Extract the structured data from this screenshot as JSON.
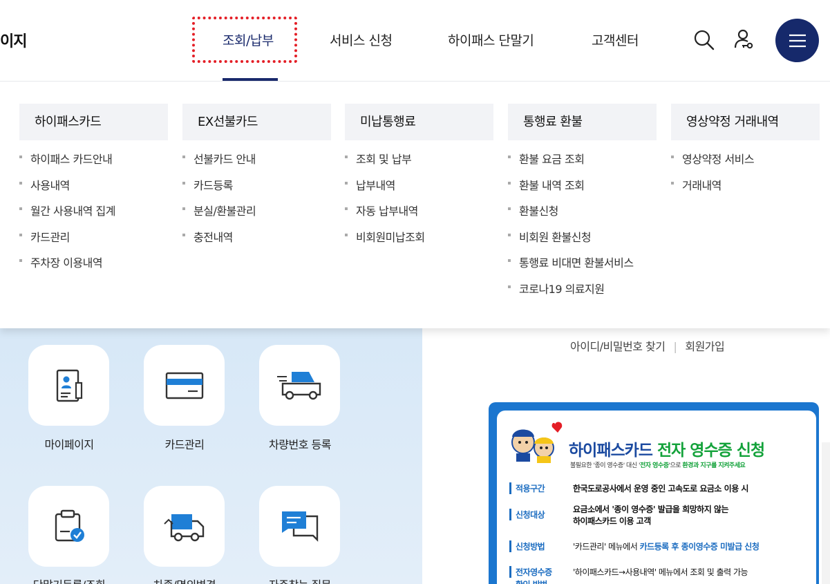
{
  "header": {
    "logo_text": "이지",
    "nav": [
      {
        "label": "조회/납부"
      },
      {
        "label": "서비스 신청"
      },
      {
        "label": "하이패스 단말기"
      },
      {
        "label": "고객센터"
      }
    ],
    "icons": {
      "search": "search-icon",
      "login": "user-key-icon",
      "menu": "hamburger-menu-icon"
    }
  },
  "mega": {
    "columns": [
      {
        "title": "하이패스카드",
        "items": [
          "하이패스 카드안내",
          "사용내역",
          "월간 사용내역 집계",
          "카드관리",
          "주차장 이용내역"
        ]
      },
      {
        "title": "EX선불카드",
        "items": [
          "선불카드 안내",
          "카드등록",
          "분실/환불관리",
          "충전내역"
        ]
      },
      {
        "title": "미납통행료",
        "items": [
          "조회 및 납부",
          "납부내역",
          "자동 납부내역",
          "비회원미납조회"
        ]
      },
      {
        "title": "통행료 환불",
        "items": [
          "환불 요금 조회",
          "환불 내역 조회",
          "환불신청",
          "비회원 환불신청",
          "통행료 비대면 환불서비스",
          "코로나19 의료지원"
        ]
      },
      {
        "title": "영상약정 거래내역",
        "items": [
          "영상약정 서비스",
          "거래내역"
        ]
      }
    ]
  },
  "quick": {
    "tiles": [
      {
        "label": "마이페이지",
        "icon": "id-card-icon"
      },
      {
        "label": "카드관리",
        "icon": "credit-card-icon"
      },
      {
        "label": "차량번호 등록",
        "icon": "car-icon"
      },
      {
        "label": "단말기등록/조회",
        "icon": "clipboard-check-icon"
      },
      {
        "label": "차종/명의변경",
        "icon": "truck-exchange-icon"
      },
      {
        "label": "자주찾는 질문",
        "icon": "chat-bubble-icon"
      }
    ]
  },
  "account": {
    "find": "아이디/비밀번호 찾기",
    "join": "회원가입"
  },
  "banner": {
    "title_a": "하이패스카드 ",
    "title_b": "전자 영수증 신청",
    "sub_a": "불필요한 '종이 영수증' 대신 '",
    "sub_b": "전자 영수증",
    "sub_c": "'으로 ",
    "sub_d": "환경과 지구를 지켜주세요",
    "rows": [
      {
        "label": "적용구간",
        "value": "한국도로공사에서 운영 중인 고속도로 요금소 이용 시"
      },
      {
        "label": "신청대상",
        "value_a": "요금소에서 '종이 영수증' 발급을 희망하지 않는",
        "value_b": "하이패스카드 이용 고객"
      },
      {
        "label": "신청방법",
        "value_a": "'카드관리' 메뉴에서 ",
        "value_b": "카드등록 후 종이영수증 미발급 신청"
      },
      {
        "label": "전자영수증",
        "value": "'하이패스카드→사용내역' 메뉴에서 조회 및 출력 가능"
      },
      {
        "label": "확인 방법",
        "value": ""
      }
    ]
  },
  "colors": {
    "primary": "#16296b",
    "highlight": "#e41e26",
    "banner": "#1b76cf",
    "green": "#13a23a"
  }
}
